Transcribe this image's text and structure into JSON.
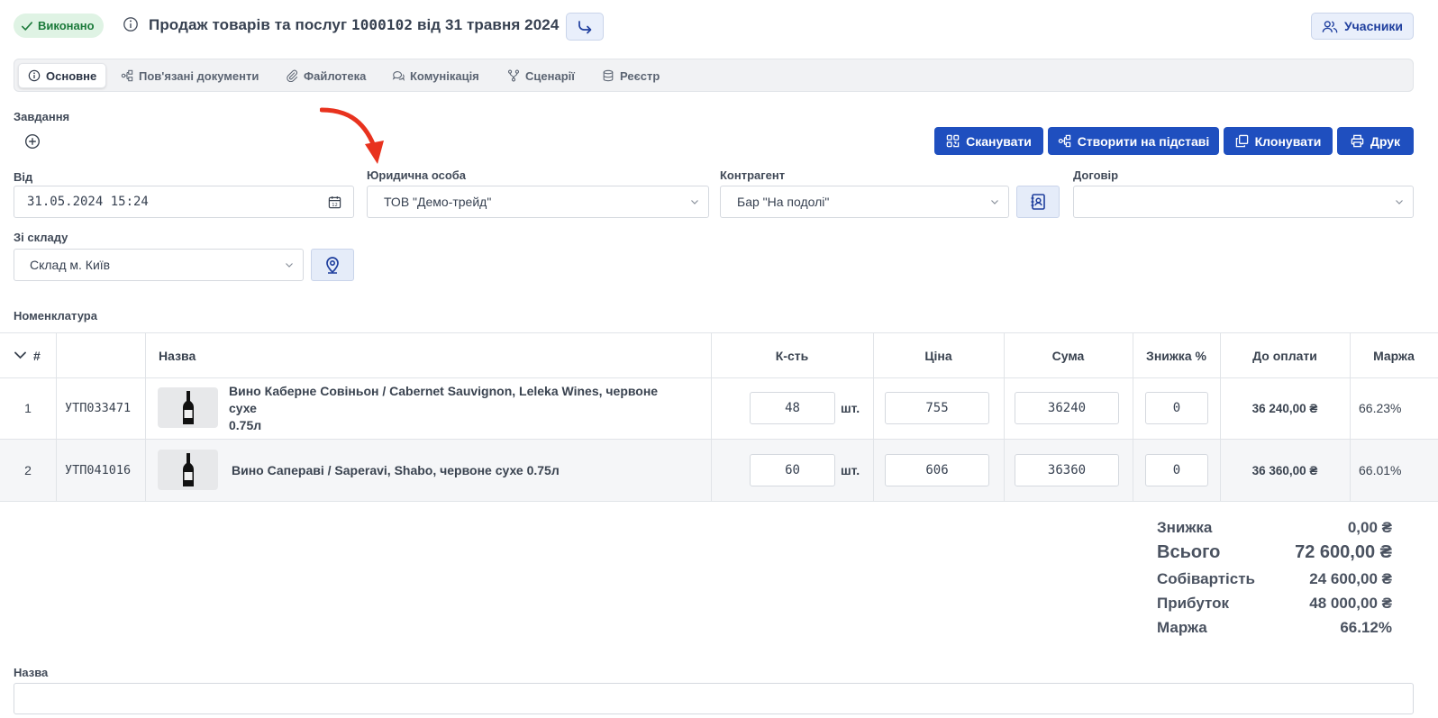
{
  "header": {
    "status": "Виконано",
    "title_prefix": "Продаж товарів та послуг",
    "doc_number": "1000102",
    "title_suffix": "від 31 травня 2024",
    "participants_label": "Учасники"
  },
  "tabs": [
    {
      "label": "Основне",
      "icon": "info-icon",
      "active": true
    },
    {
      "label": "Пов'язані документи",
      "icon": "related-docs-icon",
      "active": false
    },
    {
      "label": "Файлотека",
      "icon": "paperclip-icon",
      "active": false
    },
    {
      "label": "Комунікація",
      "icon": "chat-icon",
      "active": false
    },
    {
      "label": "Сценарії",
      "icon": "scenario-icon",
      "active": false
    },
    {
      "label": "Реєстр",
      "icon": "database-icon",
      "active": false
    }
  ],
  "tasks_label": "Завдання",
  "actions": {
    "scan": "Сканувати",
    "create_based": "Створити на підставі",
    "clone": "Клонувати",
    "print": "Друк"
  },
  "form": {
    "from_label": "Від",
    "from_value": "31.05.2024 15:24",
    "legal_entity_label": "Юридична особа",
    "legal_entity_value": "ТОВ \"Демо-трейд\"",
    "counterparty_label": "Контрагент",
    "counterparty_value": "Бар \"На подолі\"",
    "contract_label": "Договір",
    "contract_value": "",
    "warehouse_label": "Зі складу",
    "warehouse_value": "Склад м. Київ"
  },
  "nomenclature_label": "Номенклатура",
  "table": {
    "headers": {
      "num": "#",
      "name": "Назва",
      "qty": "К-сть",
      "price": "Ціна",
      "sum": "Сума",
      "discount": "Знижка %",
      "to_pay": "До оплати",
      "margin": "Маржа"
    },
    "rows": [
      {
        "num": "1",
        "code": "УТП033471",
        "name_line1": "Вино Каберне Совіньон / Cabernet Sauvignon, Leleka Wines, червоне сухе",
        "name_line2": "0.75л",
        "qty": "48",
        "unit": "шт.",
        "price": "755",
        "sum": "36240",
        "discount": "0",
        "to_pay": "36 240,00 ₴",
        "margin": "66.23%"
      },
      {
        "num": "2",
        "code": "УТП041016",
        "name_line1": "Вино Сапераві / Saperavi, Shabo, червоне сухе 0.75л",
        "name_line2": "",
        "qty": "60",
        "unit": "шт.",
        "price": "606",
        "sum": "36360",
        "discount": "0",
        "to_pay": "36 360,00 ₴",
        "margin": "66.01%"
      }
    ]
  },
  "totals": {
    "discount_label": "Знижка",
    "discount_value": "0,00 ₴",
    "total_label": "Всього",
    "total_value": "72 600,00 ₴",
    "cost_label": "Собівартість",
    "cost_value": "24 600,00 ₴",
    "profit_label": "Прибуток",
    "profit_value": "48 000,00 ₴",
    "margin_label": "Маржа",
    "margin_value": "66.12%"
  },
  "name_field_label": "Назва",
  "colors": {
    "primary": "#1f4fbf",
    "success_bg": "#dff3e4",
    "success_text": "#1b7a3a",
    "annotation_arrow": "#e8321e"
  }
}
